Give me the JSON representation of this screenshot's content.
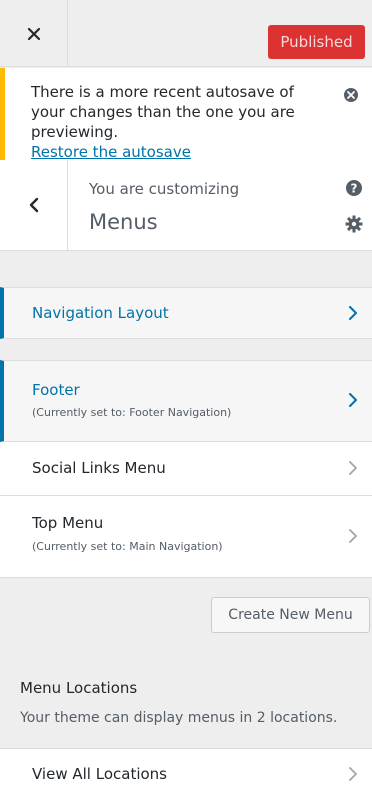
{
  "header": {
    "close_icon": "close-icon",
    "publish_label": "Published",
    "publish_color": "#dc3232"
  },
  "notice": {
    "text": "There is a more recent autosave of your changes than the one you are previewing.",
    "link": "Restore the autosave",
    "border_color": "#ffb900"
  },
  "section": {
    "customizing_label": "You are customizing",
    "title": "Menus"
  },
  "rows": [
    {
      "label": "Navigation Layout",
      "sub": ""
    },
    {
      "label": "Footer",
      "sub": "(Currently set to: Footer Navigation)"
    },
    {
      "label": "Social Links Menu",
      "sub": ""
    },
    {
      "label": "Top Menu",
      "sub": "(Currently set to: Main Navigation)"
    }
  ],
  "create_button": "Create New Menu",
  "locations": {
    "title": "Menu Locations",
    "description": "Your theme can display menus in 2 locations.",
    "view_all": "View All Locations"
  },
  "accent_color": "#0073aa"
}
